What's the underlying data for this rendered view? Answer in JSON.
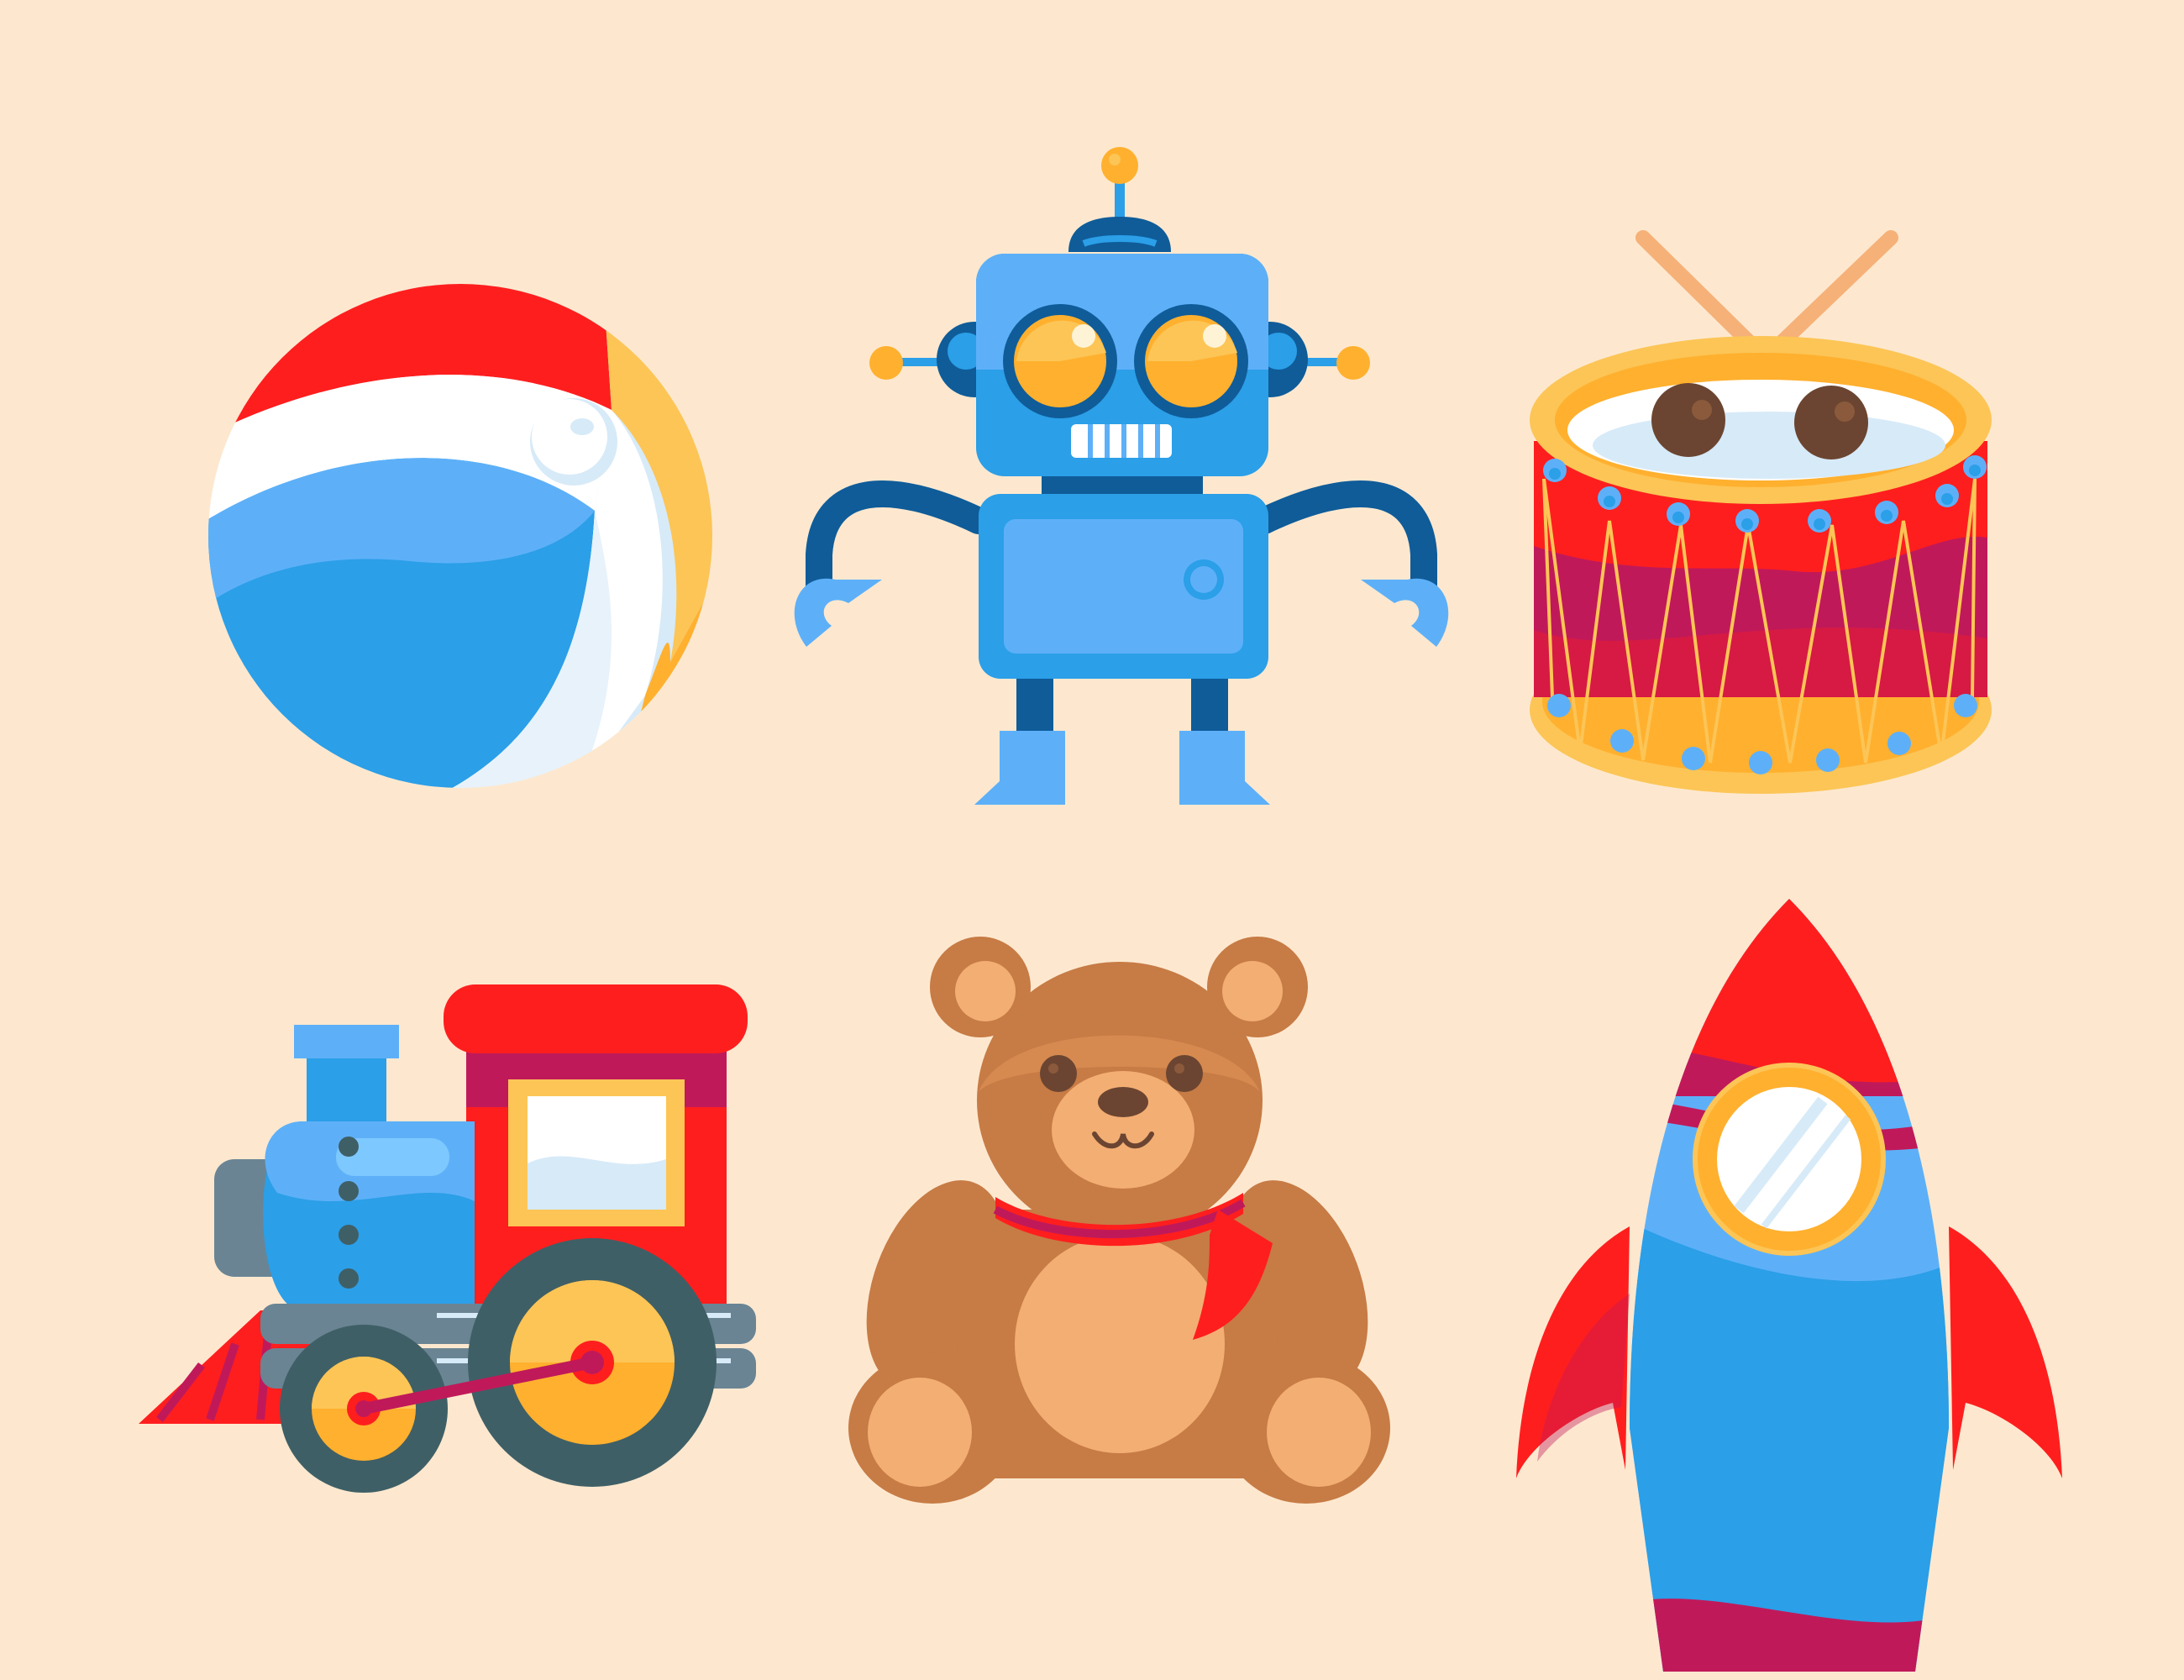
{
  "background": "#FDE8CF",
  "palette": {
    "red": "#FF1E1E",
    "magenta": "#C0195A",
    "blue": "#2B9FE8",
    "light_blue": "#5DB0F8",
    "pale_blue": "#D7EAF8",
    "dark_blue": "#0F5C99",
    "orange": "#FFB02E",
    "yellow": "#FCC556",
    "brown": "#C77B45",
    "tan": "#F3AE73",
    "slate": "#3F5F66",
    "grey": "#6A8494"
  },
  "items": [
    {
      "id": "beach-ball",
      "icon": "beach-ball-icon"
    },
    {
      "id": "robot",
      "icon": "robot-icon"
    },
    {
      "id": "drum",
      "icon": "drum-icon"
    },
    {
      "id": "train",
      "icon": "toy-train-icon"
    },
    {
      "id": "teddy-bear",
      "icon": "teddy-bear-icon"
    },
    {
      "id": "rocket",
      "icon": "rocket-icon"
    }
  ]
}
